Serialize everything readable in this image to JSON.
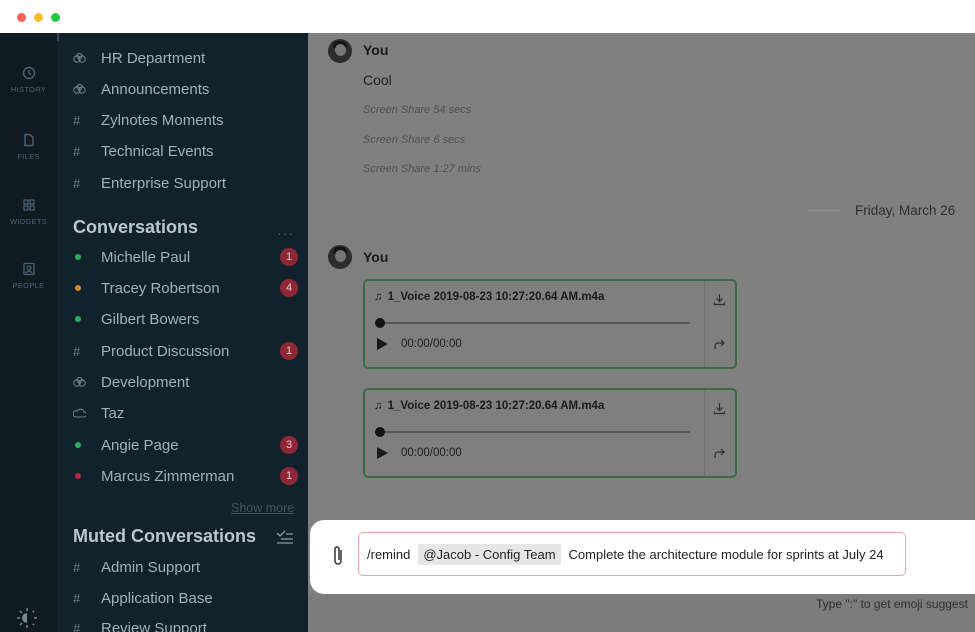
{
  "window": {
    "controls": [
      "close",
      "minimize",
      "zoom"
    ]
  },
  "rail": {
    "items": [
      {
        "label": "HISTORY",
        "icon": "history-icon"
      },
      {
        "label": "FILES",
        "icon": "file-icon"
      },
      {
        "label": "WIDGETS",
        "icon": "widgets-icon"
      },
      {
        "label": "PEOPLE",
        "icon": "people-icon"
      }
    ],
    "theme_icon": "theme-toggle-icon"
  },
  "sidebar": {
    "channels": [
      {
        "prefix": "team-icon",
        "name": "HR Department"
      },
      {
        "prefix": "team-icon",
        "name": "Announcements"
      },
      {
        "prefix": "#",
        "name": "Zylnotes Moments"
      },
      {
        "prefix": "#",
        "name": "Technical Events"
      },
      {
        "prefix": "#",
        "name": "Enterprise Support"
      }
    ],
    "conversations_title": "Conversations",
    "conversations_more": "···",
    "conversations": [
      {
        "prefix": "dot",
        "dot_color": "#27ae60",
        "name": "Michelle Paul",
        "badge": "1"
      },
      {
        "prefix": "dot",
        "dot_color": "#d68a2a",
        "name": "Tracey Robertson",
        "badge": "4"
      },
      {
        "prefix": "dot",
        "dot_color": "#27ae60",
        "name": "Gilbert Bowers",
        "badge": ""
      },
      {
        "prefix": "#",
        "name": "Product Discussion",
        "badge": "1"
      },
      {
        "prefix": "team-icon",
        "name": "Development",
        "badge": ""
      },
      {
        "prefix": "bot-icon",
        "name": "Taz",
        "badge": ""
      },
      {
        "prefix": "dot",
        "dot_color": "#27ae60",
        "name": "Angie Page",
        "badge": "3"
      },
      {
        "prefix": "dot",
        "dot_color": "#b8283e",
        "name": "Marcus Zimmerman",
        "badge": "1"
      }
    ],
    "show_more": "Show more",
    "muted_title": "Muted Conversations",
    "muted": [
      {
        "prefix": "#",
        "name": "Admin Support"
      },
      {
        "prefix": "#",
        "name": "Application Base"
      },
      {
        "prefix": "#",
        "name": "Review Support"
      }
    ]
  },
  "chat": {
    "message1": {
      "sender": "You",
      "text": "Cool",
      "events": [
        "Screen Share 54 secs",
        "Screen Share 6 secs",
        "Screen Share 1:27 mins"
      ]
    },
    "date_divider": "Friday, March 26",
    "message2": {
      "sender": "You",
      "attachments": [
        {
          "file": "1_Voice 2019-08-23 10:27:20.64 AM.m4a",
          "time": "00:00/00:00",
          "progress": 0
        },
        {
          "file": "1_Voice 2019-08-23 10:27:20.64 AM.m4a",
          "time": "00:00/00:00",
          "progress": 0
        }
      ]
    }
  },
  "composer": {
    "command": "/remind",
    "mention": "@Jacob - Config Team",
    "text": "Complete the architecture module for sprints at July 24",
    "emoji_hint": "Type \":\" to get emoji suggest"
  },
  "colors": {
    "sidebar_bg": "#12222c",
    "rail_bg": "#0f1a21",
    "badge": "#8e2836",
    "audio_border": "#3c6b47",
    "input_border": "#e6a3ac"
  }
}
